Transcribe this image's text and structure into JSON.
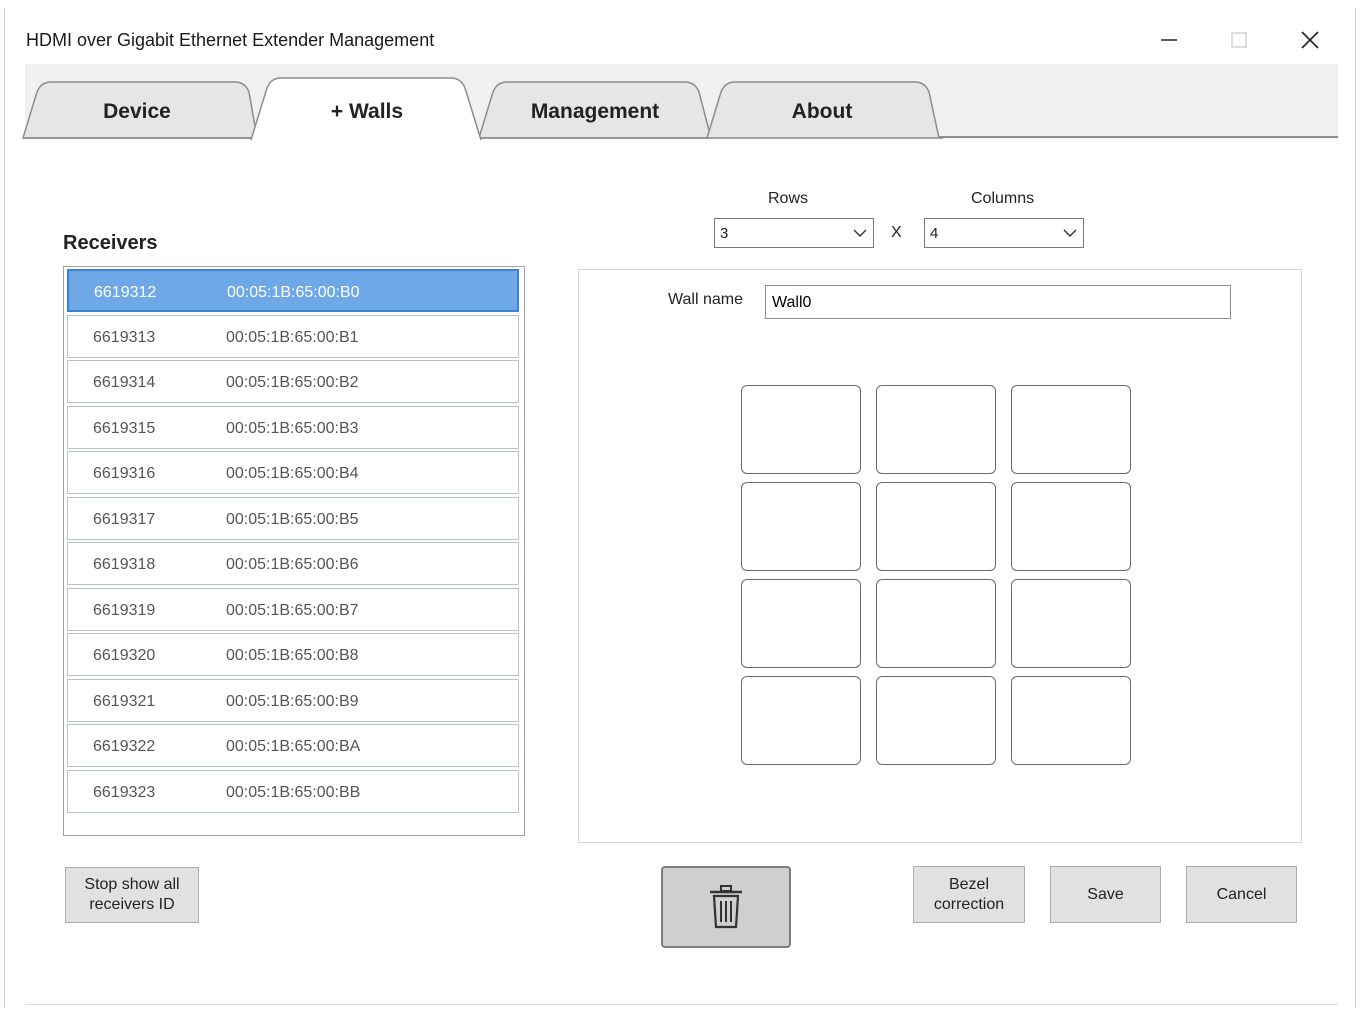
{
  "window": {
    "title": "HDMI over Gigabit Ethernet Extender Management"
  },
  "tabs": [
    {
      "label": "Device",
      "active": false
    },
    {
      "label": "+ Walls",
      "active": true
    },
    {
      "label": "Management",
      "active": false
    },
    {
      "label": "About",
      "active": false
    }
  ],
  "receivers": {
    "title": "Receivers",
    "items": [
      {
        "id": "6619312",
        "mac": "00:05:1B:65:00:B0",
        "selected": true
      },
      {
        "id": "6619313",
        "mac": "00:05:1B:65:00:B1"
      },
      {
        "id": "6619314",
        "mac": "00:05:1B:65:00:B2"
      },
      {
        "id": "6619315",
        "mac": "00:05:1B:65:00:B3"
      },
      {
        "id": "6619316",
        "mac": "00:05:1B:65:00:B4"
      },
      {
        "id": "6619317",
        "mac": "00:05:1B:65:00:B5"
      },
      {
        "id": "6619318",
        "mac": "00:05:1B:65:00:B6"
      },
      {
        "id": "6619319",
        "mac": "00:05:1B:65:00:B7"
      },
      {
        "id": "6619320",
        "mac": "00:05:1B:65:00:B8"
      },
      {
        "id": "6619321",
        "mac": "00:05:1B:65:00:B9"
      },
      {
        "id": "6619322",
        "mac": "00:05:1B:65:00:BA"
      },
      {
        "id": "6619323",
        "mac": "00:05:1B:65:00:BB"
      }
    ]
  },
  "grid": {
    "rows_label": "Rows",
    "rows_value": "3",
    "times": "X",
    "columns_label": "Columns",
    "columns_value": "4"
  },
  "wall": {
    "name_label": "Wall name",
    "name_value": "Wall0"
  },
  "buttons": {
    "stop_show": "Stop show all receivers ID",
    "bezel": "Bezel correction",
    "save": "Save",
    "cancel": "Cancel"
  },
  "icons": {
    "minimize": "minimize-icon",
    "maximize": "maximize-icon",
    "close": "close-icon",
    "delete": "trash-icon"
  },
  "colors": {
    "selected_row": "#6fa8e6",
    "tab_bg": "#f0f0f0",
    "button_bg": "#e1e1e1"
  }
}
